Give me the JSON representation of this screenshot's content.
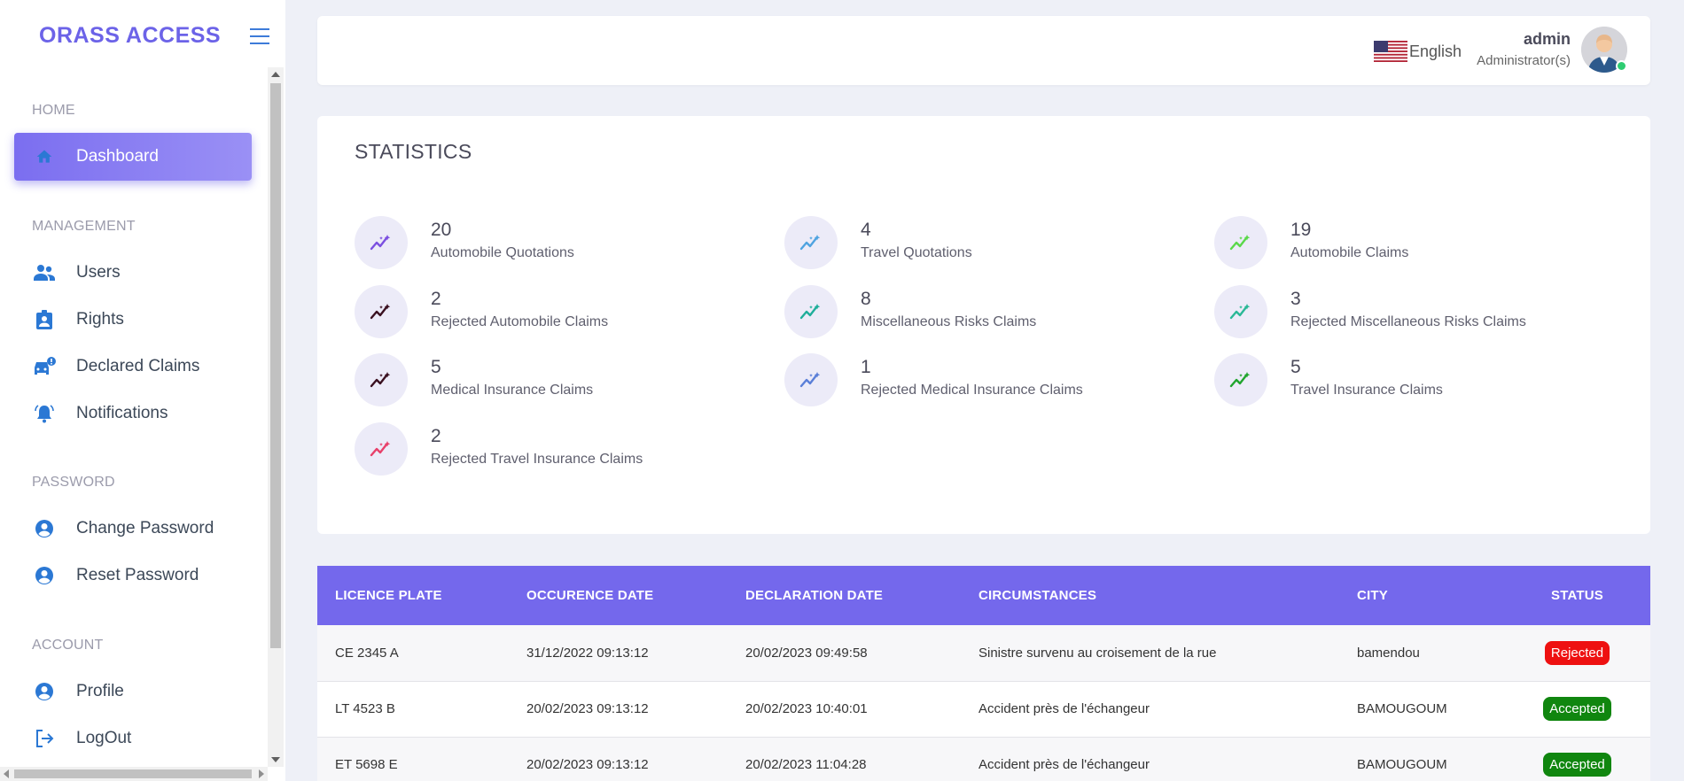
{
  "sidebar": {
    "brand": "ORASS ACCESS",
    "sections": {
      "home": "HOME",
      "management": "MANAGEMENT",
      "password": "PASSWORD",
      "account": "ACCOUNT"
    },
    "items": {
      "dashboard": "Dashboard",
      "users": "Users",
      "rights": "Rights",
      "declared_claims": "Declared Claims",
      "notifications": "Notifications",
      "change_password": "Change Password",
      "reset_password": "Reset Password",
      "profile": "Profile",
      "logout": "LogOut"
    }
  },
  "header": {
    "language": "English",
    "user_name": "admin",
    "user_role": "Administrator(s)"
  },
  "statistics": {
    "title": "STATISTICS",
    "items": [
      {
        "value": "20",
        "label": "Automobile Quotations",
        "icon_color": "#7b4fe0"
      },
      {
        "value": "4",
        "label": "Travel Quotations",
        "icon_color": "#4fa3e0"
      },
      {
        "value": "19",
        "label": "Automobile Claims",
        "icon_color": "#5ad84a"
      },
      {
        "value": "2",
        "label": "Rejected Automobile Claims",
        "icon_color": "#3a1020"
      },
      {
        "value": "8",
        "label": "Miscellaneous Risks Claims",
        "icon_color": "#1fae9a"
      },
      {
        "value": "3",
        "label": "Rejected Miscellaneous Risks Claims",
        "icon_color": "#2ab896"
      },
      {
        "value": "5",
        "label": "Medical Insurance Claims",
        "icon_color": "#3a1020"
      },
      {
        "value": "1",
        "label": "Rejected Medical Insurance Claims",
        "icon_color": "#5a7fd8"
      },
      {
        "value": "5",
        "label": "Travel Insurance Claims",
        "icon_color": "#21a52e"
      },
      {
        "value": "2",
        "label": "Rejected Travel Insurance Claims",
        "icon_color": "#e8406a"
      }
    ]
  },
  "table": {
    "headers": [
      "LICENCE PLATE",
      "OCCURENCE DATE",
      "DECLARATION DATE",
      "CIRCUMSTANCES",
      "CITY",
      "STATUS"
    ],
    "rows": [
      {
        "plate": "CE 2345 A",
        "occurence": "31/12/2022 09:13:12",
        "declaration": "20/02/2023 09:49:58",
        "circumstances": "Sinistre survenu au croisement de la rue",
        "city": "bamendou",
        "status": "Rejected"
      },
      {
        "plate": "LT 4523 B",
        "occurence": "20/02/2023 09:13:12",
        "declaration": "20/02/2023 10:40:01",
        "circumstances": "Accident près de l'échangeur",
        "city": "BAMOUGOUM",
        "status": "Accepted"
      },
      {
        "plate": "ET 5698 E",
        "occurence": "20/02/2023 09:13:12",
        "declaration": "20/02/2023 11:04:28",
        "circumstances": "Accident près de l'échangeur",
        "city": "BAMOUGOUM",
        "status": "Accepted"
      }
    ]
  },
  "colors": {
    "accent": "#7468ec",
    "brand": "#6c63e8",
    "nav_icon": "#2b78d4",
    "rejected": "#ee1111",
    "accepted": "#10860f"
  }
}
